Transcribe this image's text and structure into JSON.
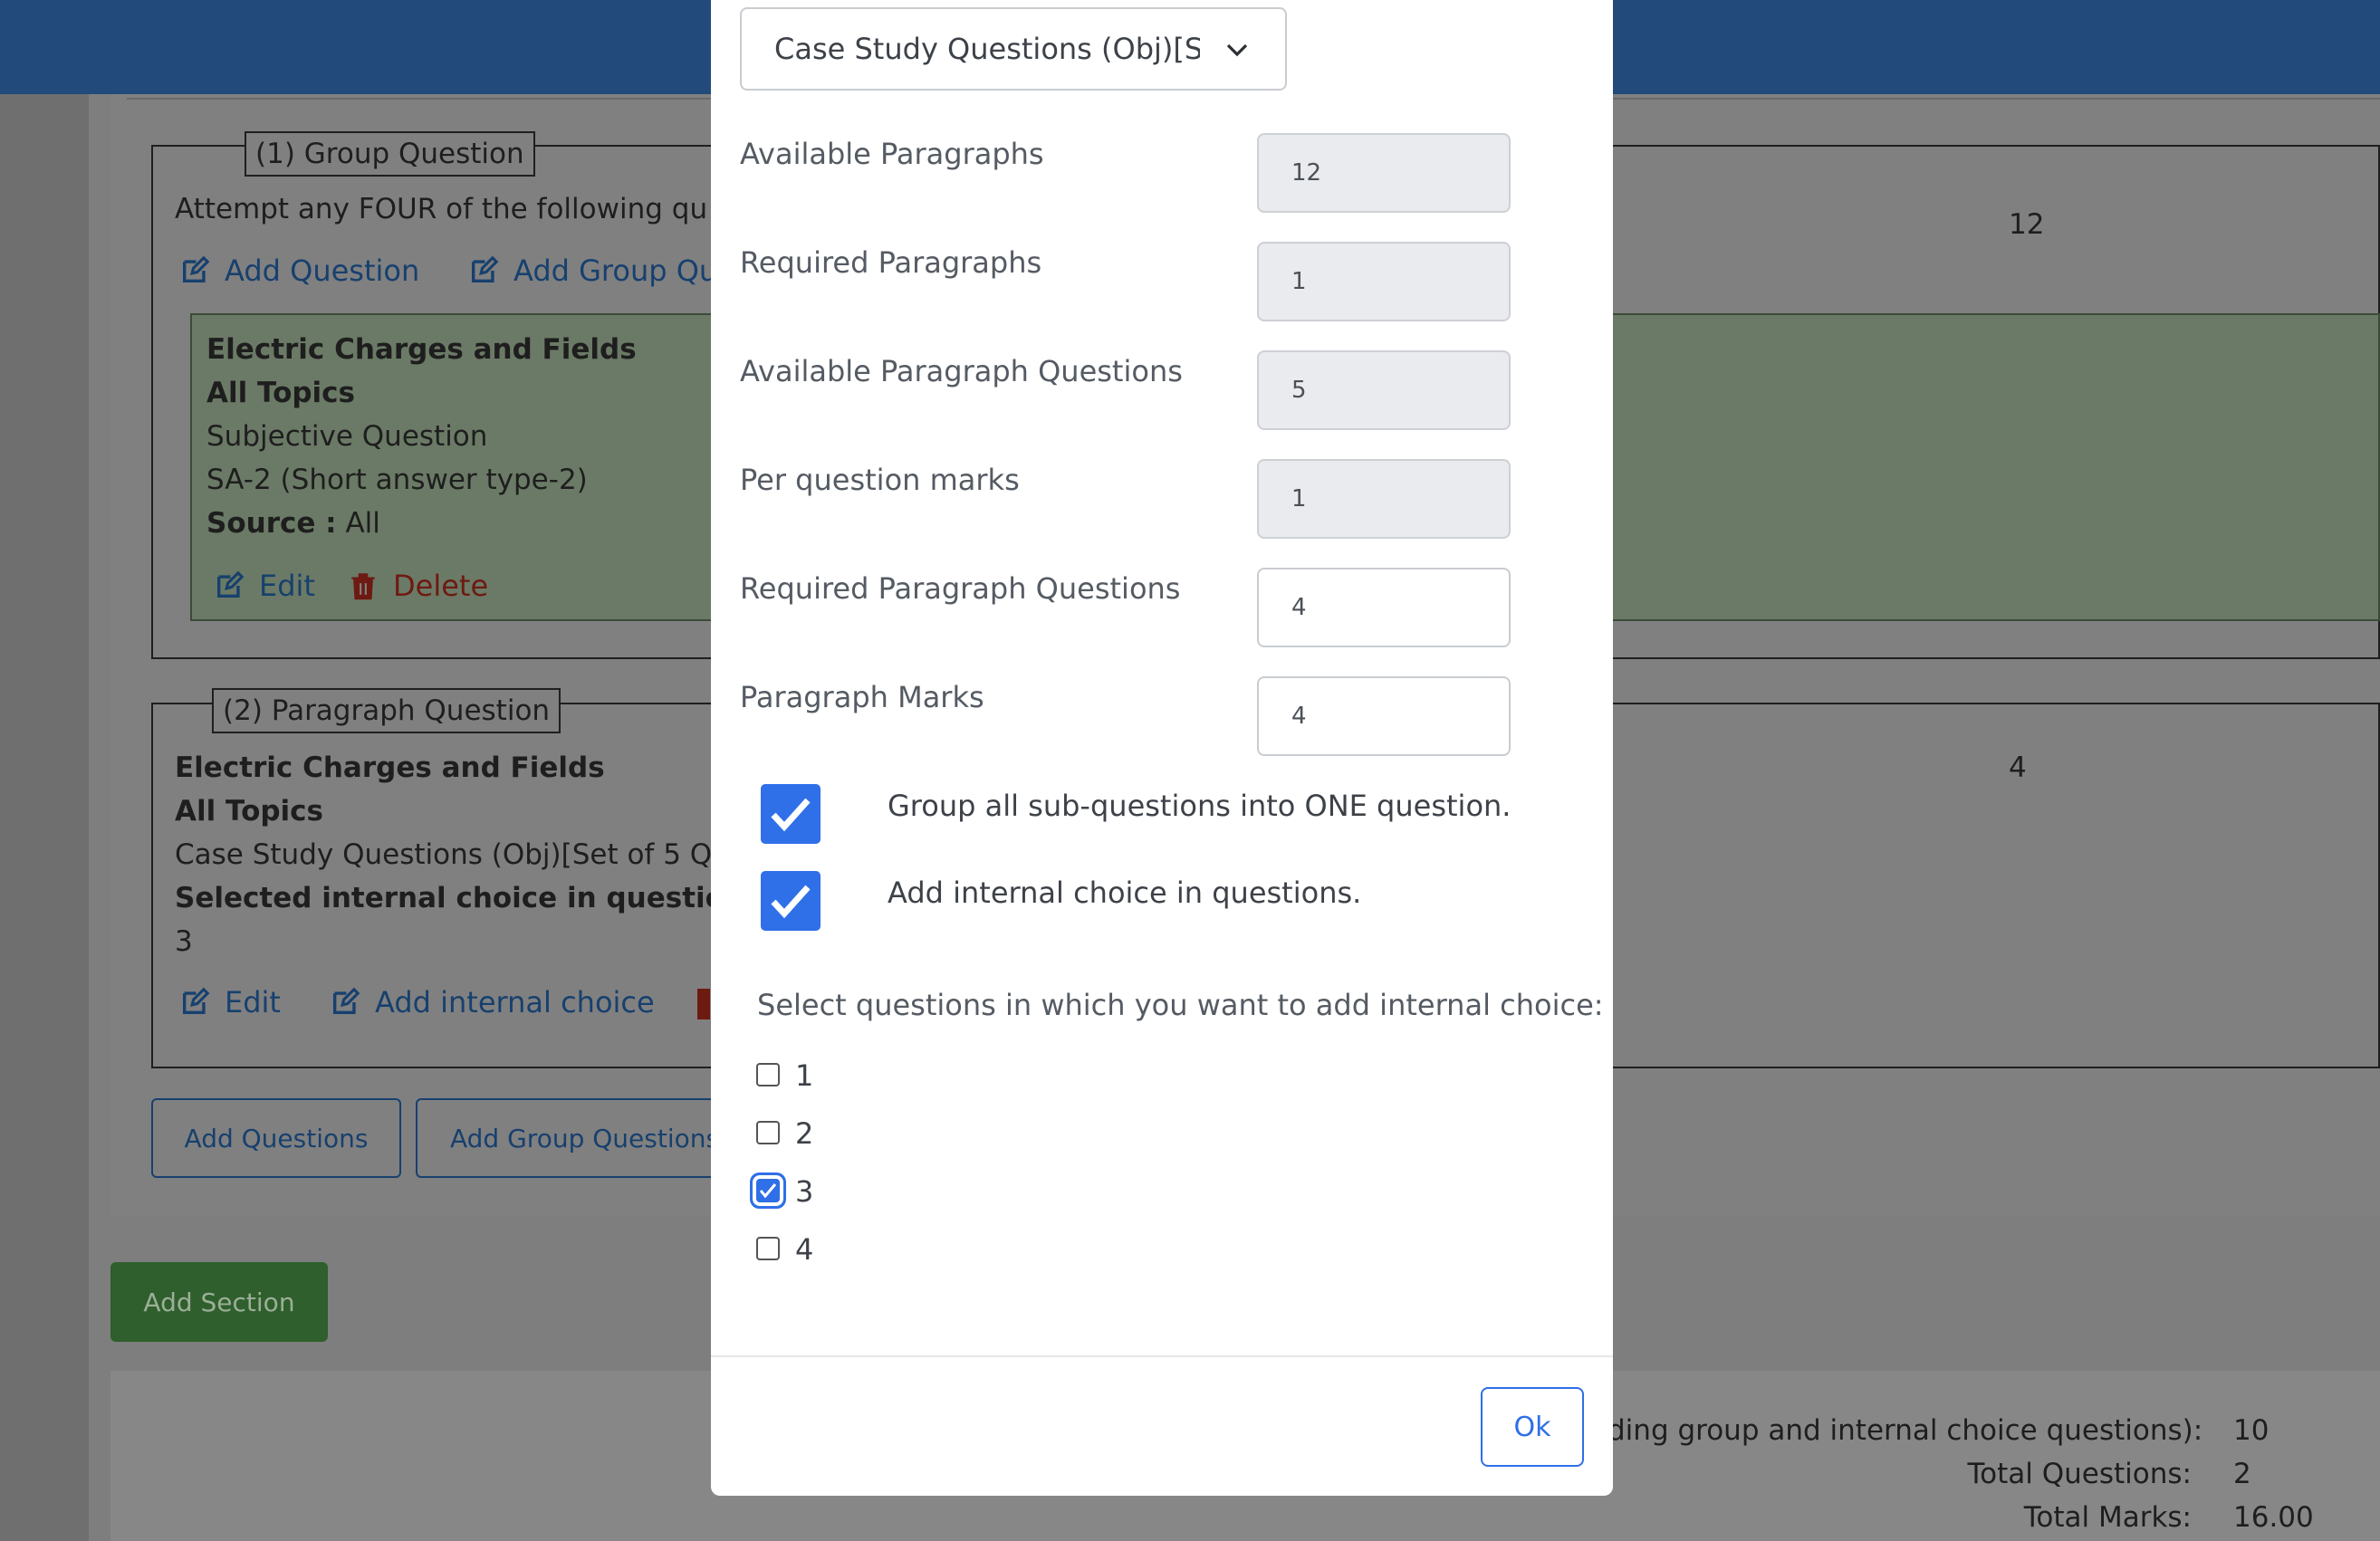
{
  "background": {
    "group_question": {
      "legend": "(1) Group Question",
      "instruction": "Attempt any FOUR of the following qu",
      "add_question": "Add Question",
      "add_group_question": "Add Group Qu",
      "marks": "12",
      "card": {
        "chapter": "Electric Charges and Fields",
        "topics": "All Topics",
        "qtype": "Subjective Question",
        "subtype": "SA-2 (Short answer type-2)",
        "source_label": "Source :",
        "source_value": "All",
        "edit": "Edit",
        "delete": "Delete"
      }
    },
    "paragraph_question": {
      "legend": "(2) Paragraph Question",
      "chapter": "Electric Charges and Fields",
      "topics": "All Topics",
      "qtype": "Case Study Questions (Obj)[Set of 5 Q",
      "selected_label": "Selected internal choice in questions:",
      "selected_value": "3",
      "marks": "4",
      "edit": "Edit",
      "add_internal_choice": "Add internal choice"
    },
    "buttons": {
      "add_questions": "Add Questions",
      "add_group_questions": "Add Group Questions",
      "add_section": "Add Section"
    },
    "summary": {
      "row1_label": "ding group and internal choice questions):",
      "row1_value": "10",
      "row2_label": "Total Questions:",
      "row2_value": "2",
      "row3_label": "Total Marks:",
      "row3_value": "16.00"
    }
  },
  "modal": {
    "question_type_select": "Case Study Questions (Obj)[S",
    "fields": [
      {
        "label": "Available Paragraphs",
        "value": "12",
        "readonly": true
      },
      {
        "label": "Required Paragraphs",
        "value": "1",
        "readonly": true
      },
      {
        "label": "Available Paragraph Questions",
        "value": "5",
        "readonly": true
      },
      {
        "label": "Per question marks",
        "value": "1",
        "readonly": true
      },
      {
        "label": "Required Paragraph Questions",
        "value": "4",
        "readonly": false
      },
      {
        "label": "Paragraph Marks",
        "value": "4",
        "readonly": false
      }
    ],
    "group_all_label": "Group all sub-questions into ONE question.",
    "group_all_checked": true,
    "internal_choice_label": "Add internal choice in questions.",
    "internal_choice_checked": true,
    "select_prompt": "Select questions in which you want to add internal choice:",
    "question_options": [
      {
        "label": "1",
        "checked": false
      },
      {
        "label": "2",
        "checked": false
      },
      {
        "label": "3",
        "checked": true
      },
      {
        "label": "4",
        "checked": false
      }
    ],
    "ok_button": "Ok"
  },
  "colors": {
    "topbar": "#224a7a",
    "overlay": "#7e7e7e",
    "accent": "#2f6fe8",
    "add_section_green": "#2e5f2c"
  }
}
